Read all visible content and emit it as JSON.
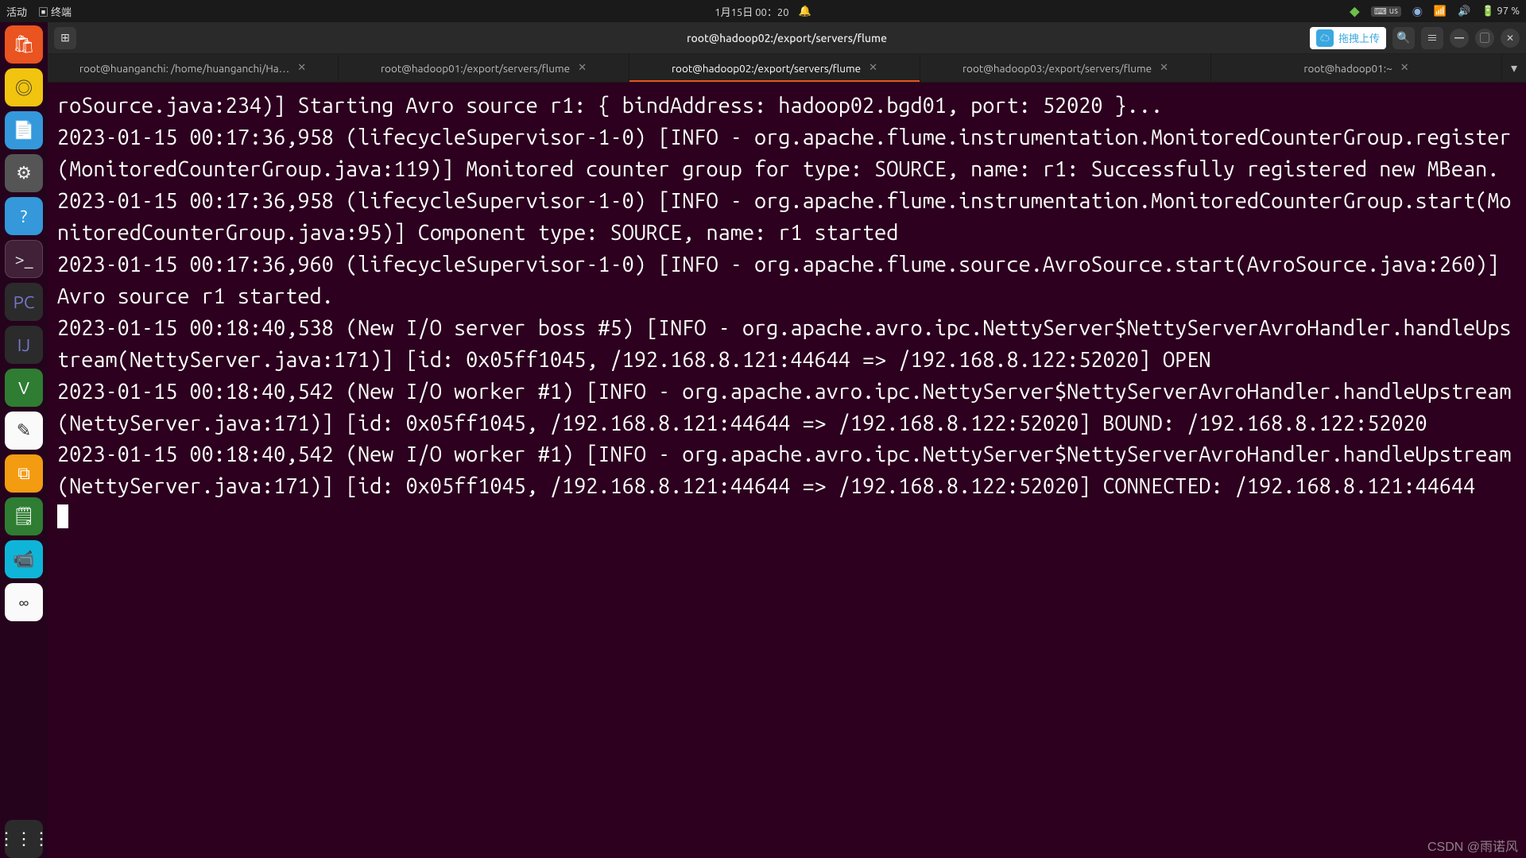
{
  "panel": {
    "activities": "活动",
    "app_indicator": "终端",
    "datetime": "1月15日  00：20",
    "battery": "97 %",
    "kbd_layout": "us"
  },
  "dock": {
    "items": [
      {
        "name": "ubuntu-software",
        "glyph": "🛍",
        "cls": "tile-orange"
      },
      {
        "name": "rhythmbox",
        "glyph": "◎",
        "cls": "tile-yellow"
      },
      {
        "name": "libreoffice-writer",
        "glyph": "📄",
        "cls": "tile-blue"
      },
      {
        "name": "settings",
        "glyph": "⚙",
        "cls": "tile-grey"
      },
      {
        "name": "help",
        "glyph": "?",
        "cls": "tile-blue"
      },
      {
        "name": "terminal",
        "glyph": ">_",
        "cls": "tile-term",
        "selected": true
      },
      {
        "name": "pycharm",
        "glyph": "PC",
        "cls": "tile-dark"
      },
      {
        "name": "intellij",
        "glyph": "IJ",
        "cls": "tile-dark"
      },
      {
        "name": "vim",
        "glyph": "V",
        "cls": "tile-green"
      },
      {
        "name": "text-editor",
        "glyph": "✎",
        "cls": "tile-white"
      },
      {
        "name": "virtualbox",
        "glyph": "⧉",
        "cls": "tile-orange2"
      },
      {
        "name": "wps",
        "glyph": "🗒",
        "cls": "tile-green"
      },
      {
        "name": "meeting",
        "glyph": "📹",
        "cls": "tile-teal"
      },
      {
        "name": "baidu-netdisk",
        "glyph": "∞",
        "cls": "tile-white"
      }
    ],
    "apps_label": "Show Applications"
  },
  "window": {
    "title": "root@hadoop02:/export/servers/flume",
    "upload_label": "拖拽上传",
    "tabs": [
      {
        "label": "root@huanganchi: /home/huanganchi/Ha…",
        "active": false
      },
      {
        "label": "root@hadoop01:/export/servers/flume",
        "active": false
      },
      {
        "label": "root@hadoop02:/export/servers/flume",
        "active": true
      },
      {
        "label": "root@hadoop03:/export/servers/flume",
        "active": false
      },
      {
        "label": "root@hadoop01:~",
        "active": false
      }
    ]
  },
  "terminal": {
    "lines": [
      "roSource.java:234)] Starting Avro source r1: { bindAddress: hadoop02.bgd01, port: 52020 }...",
      "2023-01-15 00:17:36,958 (lifecycleSupervisor-1-0) [INFO - org.apache.flume.instrumentation.MonitoredCounterGroup.register(MonitoredCounterGroup.java:119)] Monitored counter group for type: SOURCE, name: r1: Successfully registered new MBean.",
      "2023-01-15 00:17:36,958 (lifecycleSupervisor-1-0) [INFO - org.apache.flume.instrumentation.MonitoredCounterGroup.start(MonitoredCounterGroup.java:95)] Component type: SOURCE, name: r1 started",
      "2023-01-15 00:17:36,960 (lifecycleSupervisor-1-0) [INFO - org.apache.flume.source.AvroSource.start(AvroSource.java:260)] Avro source r1 started.",
      "2023-01-15 00:18:40,538 (New I/O server boss #5) [INFO - org.apache.avro.ipc.NettyServer$NettyServerAvroHandler.handleUpstream(NettyServer.java:171)] [id: 0x05ff1045, /192.168.8.121:44644 => /192.168.8.122:52020] OPEN",
      "2023-01-15 00:18:40,542 (New I/O worker #1) [INFO - org.apache.avro.ipc.NettyServer$NettyServerAvroHandler.handleUpstream(NettyServer.java:171)] [id: 0x05ff1045, /192.168.8.121:44644 => /192.168.8.122:52020] BOUND: /192.168.8.122:52020",
      "2023-01-15 00:18:40,542 (New I/O worker #1) [INFO - org.apache.avro.ipc.NettyServer$NettyServerAvroHandler.handleUpstream(NettyServer.java:171)] [id: 0x05ff1045, /192.168.8.121:44644 => /192.168.8.122:52020] CONNECTED: /192.168.8.121:44644"
    ]
  },
  "watermark": "CSDN @雨诺风"
}
